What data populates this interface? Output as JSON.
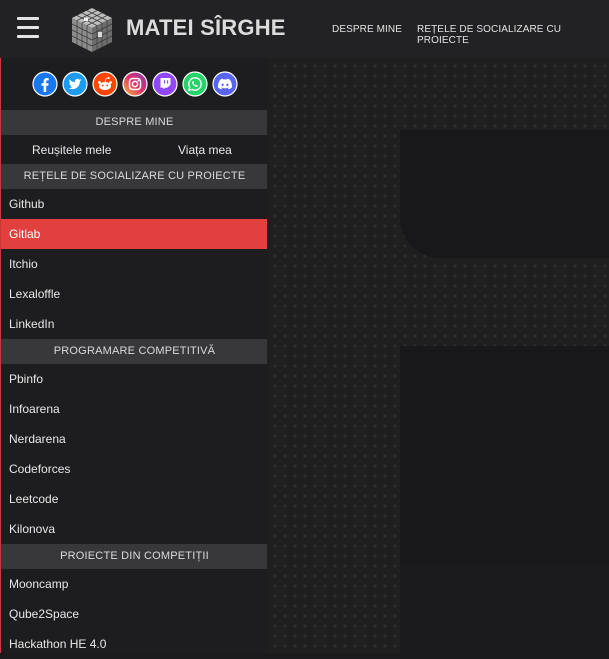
{
  "header": {
    "brand": "MATEI SÎRGHE",
    "nav": [
      "DESPRE MINE",
      "REȚELE DE SOCIALIZARE CU PROIECTE"
    ]
  },
  "social_icons": [
    {
      "name": "facebook-icon",
      "color": "#1877f2"
    },
    {
      "name": "twitter-icon",
      "color": "#1d9bf0"
    },
    {
      "name": "reddit-icon",
      "color": "#ff4500"
    },
    {
      "name": "instagram-icon",
      "color": "#d6249f"
    },
    {
      "name": "twitch-icon",
      "color": "#9146ff"
    },
    {
      "name": "whatsapp-icon",
      "color": "#25d366"
    },
    {
      "name": "discord-icon",
      "color": "#5865f2"
    }
  ],
  "sidebar": {
    "sections": [
      {
        "title": "DESPRE MINE"
      },
      {
        "title": "REȚELE DE SOCIALIZARE CU PROIECTE"
      },
      {
        "title": "PROGRAMARE COMPETITIVĂ"
      },
      {
        "title": "PROIECTE DIN COMPETIȚII"
      }
    ],
    "about_links": [
      "Reușitele mele",
      "Viața mea"
    ],
    "social_links": [
      "Github",
      "Gitlab",
      "Itchio",
      "Lexaloffle",
      "LinkedIn"
    ],
    "competitive_links": [
      "Pbinfo",
      "Infoarena",
      "Nerdarena",
      "Codeforces",
      "Leetcode",
      "Kilonova"
    ],
    "competition_projects": [
      "Mooncamp",
      "Qube2Space",
      "Hackathon HE 4.0"
    ],
    "active_item": "Gitlab",
    "accent": "#e1403f"
  }
}
